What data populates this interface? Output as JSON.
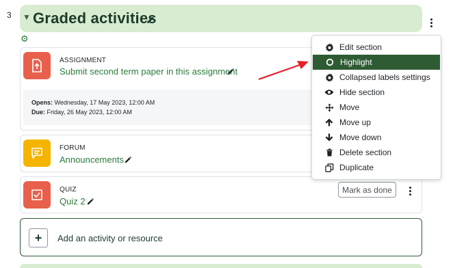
{
  "section": {
    "number": "3",
    "title": "Graded activities"
  },
  "activities": [
    {
      "type": "ASSIGNMENT",
      "name": "Submit second term paper in this assignment",
      "icon": "assignment-icon",
      "color": "#e8604c",
      "opens_label": "Opens:",
      "opens_value": " Wednesday, 17 May 2023, 12:00 AM",
      "due_label": "Due:",
      "due_value": " Friday, 26 May 2023, 12:00 AM"
    },
    {
      "type": "FORUM",
      "name": "Announcements",
      "icon": "forum-icon",
      "color": "#f5b400"
    },
    {
      "type": "QUIZ",
      "name": "Quiz 2",
      "icon": "quiz-icon",
      "color": "#e8604c",
      "mark_done": "Mark as done"
    }
  ],
  "add_activity": {
    "label": "Add an activity or resource"
  },
  "menu": {
    "items": [
      {
        "label": "Edit section",
        "icon": "gear-icon"
      },
      {
        "label": "Highlight",
        "icon": "circle-icon",
        "active": true
      },
      {
        "label": "Collapsed labels settings",
        "icon": "gear-icon"
      },
      {
        "label": "Hide section",
        "icon": "eye-icon"
      },
      {
        "label": "Move",
        "icon": "move-icon"
      },
      {
        "label": "Move up",
        "icon": "arrow-up-icon"
      },
      {
        "label": "Move down",
        "icon": "arrow-down-icon"
      },
      {
        "label": "Delete section",
        "icon": "trash-icon"
      },
      {
        "label": "Duplicate",
        "icon": "duplicate-icon"
      }
    ]
  },
  "colors": {
    "section_bg": "#d7ecd0",
    "link": "#2b7a3b",
    "menu_active": "#2e5b33",
    "arrow": "#e8202a"
  }
}
